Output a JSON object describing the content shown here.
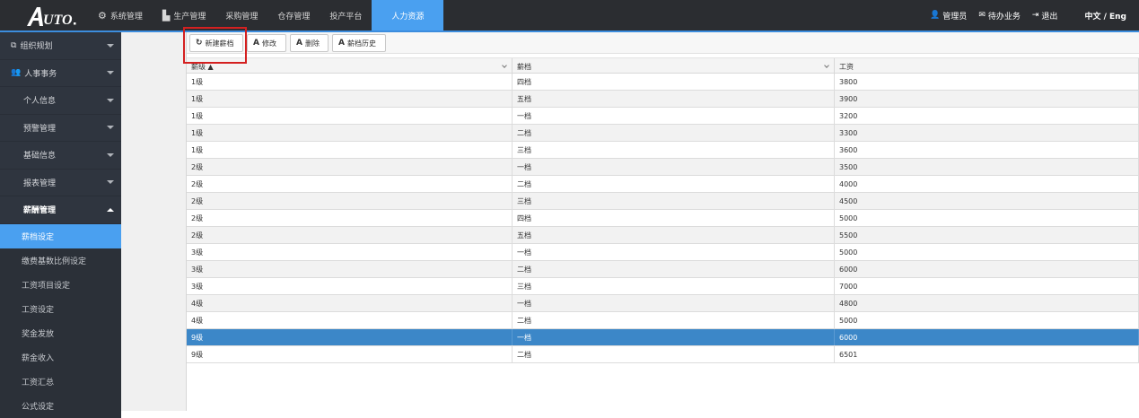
{
  "brand": {
    "logo_text": "AUTO"
  },
  "nav": {
    "items": [
      {
        "label": "系统管理",
        "icon": "gear-icon"
      },
      {
        "label": "生产管理",
        "icon": "factory-icon"
      },
      {
        "label": "采购管理",
        "icon": ""
      },
      {
        "label": "仓存管理",
        "icon": ""
      },
      {
        "label": "投产平台",
        "icon": ""
      },
      {
        "label": "人力资源",
        "icon": "",
        "active": true
      }
    ]
  },
  "top_right": {
    "user_label": "管理员",
    "tasks_label": "待办业务",
    "logout_label": "退出",
    "language_label": "中文 / Eng"
  },
  "sidebar": {
    "sections": [
      {
        "label": "组织规划",
        "icon": "org-chart-icon"
      },
      {
        "label": "人事事务",
        "icon": "users-icon"
      },
      {
        "label": "个人信息"
      },
      {
        "label": "预警管理"
      },
      {
        "label": "基础信息"
      },
      {
        "label": "报表管理"
      },
      {
        "label": "薪酬管理",
        "expanded": true
      }
    ],
    "sub_items": [
      {
        "label": "薪档设定",
        "active": true
      },
      {
        "label": "缴费基数比例设定"
      },
      {
        "label": "工资项目设定"
      },
      {
        "label": "工资设定"
      },
      {
        "label": "奖金发放"
      },
      {
        "label": "薪金收入"
      },
      {
        "label": "工资汇总"
      },
      {
        "label": "公式设定"
      }
    ]
  },
  "toolbar": {
    "new_label": "新建薪档",
    "edit_label": "修改",
    "delete_label": "删除",
    "history_label": "薪档历史"
  },
  "table": {
    "columns": [
      "薪级 ▲",
      "薪档",
      "工资"
    ],
    "rows": [
      [
        "1级",
        "四档",
        "3800"
      ],
      [
        "1级",
        "五档",
        "3900"
      ],
      [
        "1级",
        "一档",
        "3200"
      ],
      [
        "1级",
        "二档",
        "3300"
      ],
      [
        "1级",
        "三档",
        "3600"
      ],
      [
        "2级",
        "一档",
        "3500"
      ],
      [
        "2级",
        "二档",
        "4000"
      ],
      [
        "2级",
        "三档",
        "4500"
      ],
      [
        "2级",
        "四档",
        "5000"
      ],
      [
        "2级",
        "五档",
        "5500"
      ],
      [
        "3级",
        "一档",
        "5000"
      ],
      [
        "3级",
        "二档",
        "6000"
      ],
      [
        "3级",
        "三档",
        "7000"
      ],
      [
        "4级",
        "一档",
        "4800"
      ],
      [
        "4级",
        "二档",
        "5000"
      ],
      [
        "9级",
        "一档",
        "6000"
      ],
      [
        "9级",
        "二档",
        "6501"
      ]
    ],
    "selected_row": 15
  },
  "colors": {
    "topbar": "#2b2d31",
    "accent": "#4aa0f0",
    "sidebar": "#2f353f",
    "selected_row": "#3c87c8",
    "highlight": "#d42020"
  }
}
